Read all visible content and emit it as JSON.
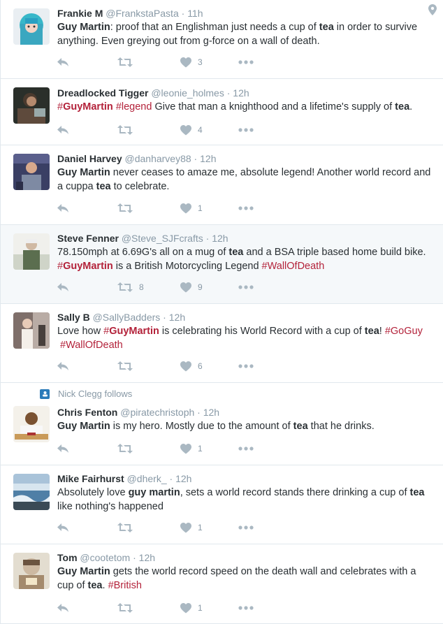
{
  "tweets": [
    {
      "fullname": "Frankie M",
      "username": "@FrankstaPasta",
      "time": "11h",
      "text_html": "<b>Guy Martin</b>: proof that an Englishman just needs a cup of <b>tea</b> in order to survive anything. Even greying out from g-force on a wall of death.",
      "likes": "3",
      "retweets": ""
    },
    {
      "fullname": "Dreadlocked Tigger",
      "username": "@leonie_holmes",
      "time": "12h",
      "text_html": "<span class=\"hashtag\">#<b>GuyMartin</b></span> <span class=\"hashtag\">#legend</span> Give that man a knighthood and a lifetime's supply of <b>tea</b>.",
      "likes": "4",
      "retweets": ""
    },
    {
      "fullname": "Daniel Harvey",
      "username": "@danharvey88",
      "time": "12h",
      "text_html": "<b>Guy Martin</b> never ceases to amaze me, absolute legend! Another world record and a cuppa <b>tea</b> to celebrate.",
      "likes": "1",
      "retweets": ""
    },
    {
      "fullname": "Steve Fenner",
      "username": "@Steve_SJFcrafts",
      "time": "12h",
      "text_html": "78.150mph at 6.69G's all on a mug of <b>tea</b> and a BSA triple based home build bike. <span class=\"hashtag\">#<b>GuyMartin</b></span> is a British Motorcycling Legend <span class=\"hashtag\">#WallOfDeath</span>",
      "likes": "9",
      "retweets": "8"
    },
    {
      "fullname": "Sally B",
      "username": "@SallyBadders",
      "time": "12h",
      "text_html": "Love how <span class=\"hashtag\">#<b>GuyMartin</b></span> is celebrating his World Record with a cup of <b>tea</b>! <span class=\"hashtag\">#GoGuy</span> &nbsp;<span class=\"hashtag\">#WallOfDeath</span>",
      "likes": "6",
      "retweets": ""
    },
    {
      "context": "Nick Clegg follows",
      "fullname": "Chris Fenton",
      "username": "@piratechristoph",
      "time": "12h",
      "text_html": "<b>Guy Martin</b> is my hero. Mostly due to the amount of <b>tea</b> that he drinks.",
      "likes": "1",
      "retweets": ""
    },
    {
      "fullname": "Mike Fairhurst",
      "username": "@dherk_",
      "time": "12h",
      "text_html": "Absolutely love <b>guy martin</b>, sets a world record stands there drinking a cup of <b>tea</b> like nothing's happened",
      "likes": "1",
      "retweets": ""
    },
    {
      "fullname": "Tom",
      "username": "@cootetom",
      "time": "12h",
      "text_html": "<b>Guy Martin</b> gets the world record speed on the death wall and celebrates with a cup of <b>tea</b>. <span class=\"hashtag\">#British</span>",
      "likes": "1",
      "retweets": ""
    }
  ],
  "colors": {
    "hashtag": "#b3223a",
    "muted": "#8899a6",
    "text": "#292f33",
    "border": "#e1e8ed",
    "highlight_bg": "#f5f8fa",
    "context_icon": "#2b7bb9"
  },
  "icons": [
    "reply-icon",
    "retweet-icon",
    "heart-icon",
    "more-icon",
    "location-icon",
    "follow-context-icon"
  ]
}
